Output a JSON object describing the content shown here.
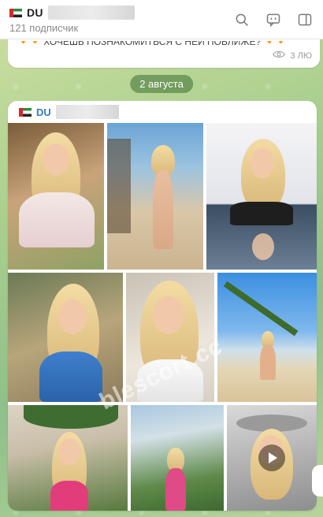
{
  "header": {
    "channel_name": "DU",
    "subscribers": "121 подписчик",
    "icons": [
      "search-icon",
      "comments-icon",
      "sidebar-toggle-icon"
    ]
  },
  "previous_message": {
    "text": "🔸🔸 ХОЧЕШЬ ПОЗНАКОМИТЬСЯ С НЕЙ ПОБЛИЖЕ? 🔸🔸",
    "time": "3 ЛЮ"
  },
  "date_separator": "2 августа",
  "post": {
    "author": "DU",
    "watermark": "blescort.cc",
    "photos": [
      {
        "name": "photo-1",
        "theme": "floral-top"
      },
      {
        "name": "photo-2",
        "theme": "beach-hammock"
      },
      {
        "name": "photo-3",
        "theme": "mirror-reflection"
      },
      {
        "name": "photo-4",
        "theme": "blue-top"
      },
      {
        "name": "photo-5",
        "theme": "white-jacket"
      },
      {
        "name": "photo-6",
        "theme": "palm-beach"
      },
      {
        "name": "photo-7",
        "theme": "pink-dress-palm"
      },
      {
        "name": "photo-8",
        "theme": "pink-dress-garden"
      },
      {
        "name": "video-9",
        "theme": "hat-video"
      }
    ]
  },
  "colors": {
    "accent": "#2f7fbf",
    "date_pill": "#5c894b"
  }
}
